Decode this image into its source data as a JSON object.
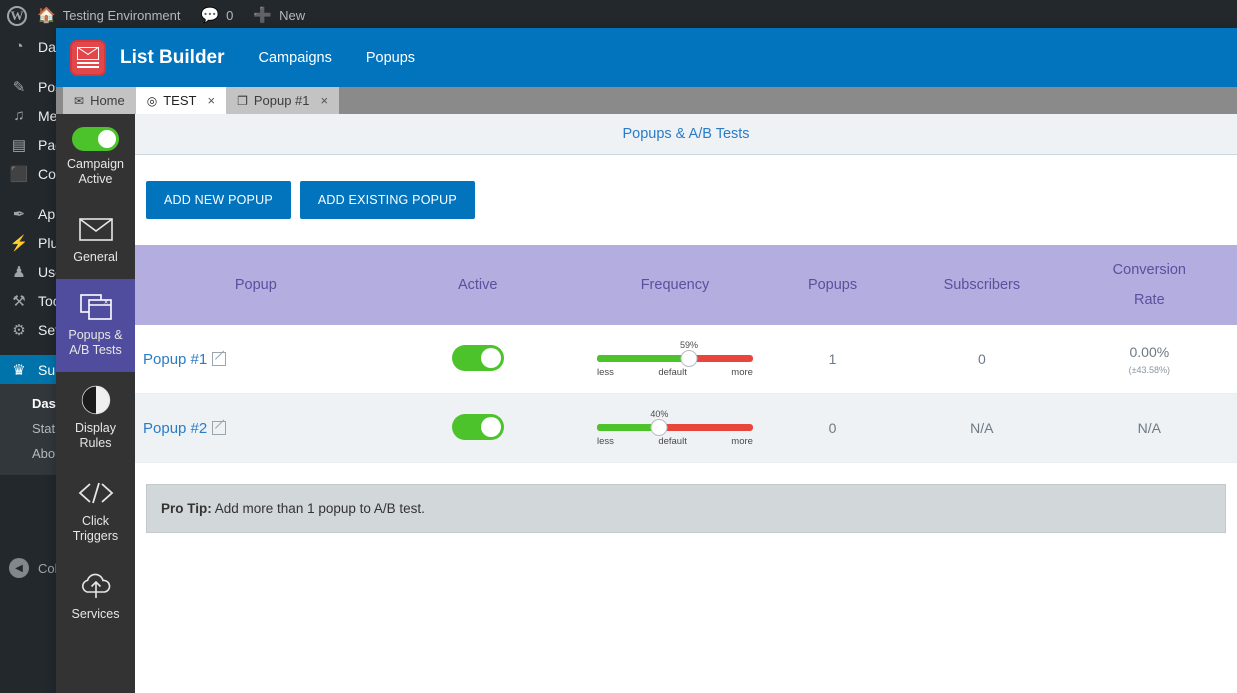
{
  "adminbar": {
    "logo_icon": "wordpress-logo-icon",
    "home_icon": "home-icon",
    "site_name": "Testing Environment",
    "comments_icon": "comment-bubble-icon",
    "comments_count": "0",
    "new_icon": "plus-icon",
    "new_label": "New"
  },
  "wp_sidebar": {
    "items": [
      {
        "icon": "dashboard-icon",
        "glyph": "◔",
        "label": "Dashboard",
        "current": false,
        "sep": false
      },
      {
        "icon": "pin-icon",
        "glyph": "✎",
        "label": "Posts",
        "current": false,
        "sep": true
      },
      {
        "icon": "media-icon",
        "glyph": "♫",
        "label": "Media",
        "current": false,
        "sep": false
      },
      {
        "icon": "pages-icon",
        "glyph": "▤",
        "label": "Pages",
        "current": false,
        "sep": false
      },
      {
        "icon": "comments-icon",
        "glyph": "⬛",
        "label": "Comments",
        "current": false,
        "sep": false
      },
      {
        "icon": "appearance-icon",
        "glyph": "✒",
        "label": "Appearance",
        "current": false,
        "sep": true
      },
      {
        "icon": "plugins-icon",
        "glyph": "⚡",
        "label": "Plugins",
        "current": false,
        "sep": false
      },
      {
        "icon": "users-icon",
        "glyph": "♟",
        "label": "Users",
        "current": false,
        "sep": false
      },
      {
        "icon": "tools-icon",
        "glyph": "⚒",
        "label": "Tools",
        "current": false,
        "sep": false
      },
      {
        "icon": "settings-icon",
        "glyph": "⚙",
        "label": "Settings",
        "current": false,
        "sep": false
      },
      {
        "icon": "crown-icon",
        "glyph": "♛",
        "label": "Sumo",
        "current": true,
        "sep": true
      }
    ],
    "submenu": [
      {
        "label": "Dashboard",
        "active": true
      },
      {
        "label": "Statistics",
        "active": false
      },
      {
        "label": "About",
        "active": false
      }
    ],
    "collapse_icon": "collapse-arrow-icon",
    "collapse_label": "Collapse menu"
  },
  "plugin": {
    "logo_icon": "list-builder-envelope-logo",
    "title": "List Builder",
    "nav": [
      {
        "label": "Campaigns",
        "name": "nav-campaigns"
      },
      {
        "label": "Popups",
        "name": "nav-popups"
      }
    ]
  },
  "tabs": [
    {
      "label": "Home",
      "icon": "envelope-icon",
      "glyph": "✉",
      "active": false,
      "closable": false
    },
    {
      "label": "TEST",
      "icon": "target-icon",
      "glyph": "◎",
      "active": true,
      "closable": true
    },
    {
      "label": "Popup #1",
      "icon": "windows-icon",
      "glyph": "❐",
      "active": false,
      "closable": true
    }
  ],
  "tab_close_glyph": "×",
  "icon_sidebar": {
    "toggle": {
      "icon": "campaign-active-toggle",
      "state": "on",
      "label_line1": "Campaign",
      "label_line2": "Active",
      "color": "#4cc32b"
    },
    "items": [
      {
        "icon": "envelope-icon",
        "label": "General",
        "active": false
      },
      {
        "icon": "popups-windows-icon",
        "label_line1": "Popups &",
        "label_line2": "A/B Tests",
        "active": true
      },
      {
        "icon": "half-circle-icon",
        "label_line1": "Display",
        "label_line2": "Rules",
        "active": false
      },
      {
        "icon": "code-brackets-icon",
        "label_line1": "Click",
        "label_line2": "Triggers",
        "active": false
      },
      {
        "icon": "cloud-upload-icon",
        "label": "Services",
        "active": false
      }
    ],
    "active_color": "#514d9e"
  },
  "content": {
    "section_title": "Popups & A/B Tests",
    "buttons": [
      {
        "label": "ADD NEW POPUP",
        "name": "add-new-popup-button"
      },
      {
        "label": "ADD EXISTING POPUP",
        "name": "add-existing-popup-button"
      }
    ],
    "table": {
      "headers": [
        {
          "label": "Popup",
          "name": "col-popup"
        },
        {
          "label": "Active",
          "name": "col-active"
        },
        {
          "label": "Frequency",
          "name": "col-frequency"
        },
        {
          "label": "Popups",
          "name": "col-popups"
        },
        {
          "label": "Subscribers",
          "name": "col-subscribers"
        },
        {
          "label_line1": "Conversion",
          "label_line2": "Rate",
          "name": "col-conversion-rate"
        }
      ],
      "rows": [
        {
          "name": "Popup #1",
          "active": true,
          "frequency_pct": "59%",
          "frequency_value": 59,
          "slider_labels": {
            "less": "less",
            "default": "default",
            "more": "more"
          },
          "popups": "1",
          "subscribers": "0",
          "conversion_rate": "0.00%",
          "conversion_margin": "(±43.58%)"
        },
        {
          "name": "Popup #2",
          "active": true,
          "frequency_pct": "40%",
          "frequency_value": 40,
          "slider_labels": {
            "less": "less",
            "default": "default",
            "more": "more"
          },
          "popups": "0",
          "subscribers": "N/A",
          "conversion_rate": "N/A",
          "conversion_margin": ""
        }
      ]
    },
    "protip": {
      "label": "Pro Tip:",
      "text": " Add more than 1 popup to A/B test."
    }
  },
  "colors": {
    "wp_dark": "#23282d",
    "plugin_blue": "#0274be",
    "table_header_purple": "#b3aedf",
    "sidebar_active_purple": "#514d9e",
    "toggle_green": "#4cc32b",
    "slider_red": "#e8463c",
    "link_blue": "#2a7cc7"
  }
}
